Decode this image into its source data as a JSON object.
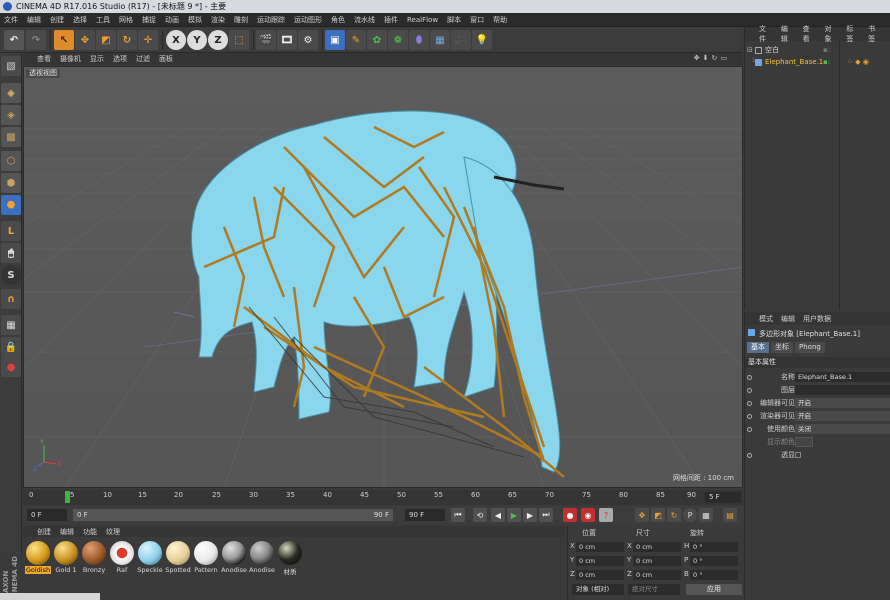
{
  "window": {
    "title": "CINEMA 4D R17.016 Studio (R17) - [未标题 9 *] - 主要"
  },
  "menubar": {
    "items": [
      "文件",
      "编辑",
      "创建",
      "选择",
      "工具",
      "网格",
      "捕捉",
      "动画",
      "模拟",
      "渲染",
      "雕刻",
      "运动跟踪",
      "运动图形",
      "角色",
      "流水线",
      "插件",
      "RealFlow",
      "脚本",
      "窗口",
      "帮助"
    ]
  },
  "viewport": {
    "menu": [
      "查看",
      "摄像机",
      "显示",
      "选项",
      "过滤",
      "面板"
    ],
    "name": "透视视图",
    "grid_spacing": "网格间距 : 100 cm"
  },
  "timeline": {
    "ticks": [
      "0",
      "5",
      "10",
      "15",
      "20",
      "25",
      "30",
      "35",
      "40",
      "45",
      "50",
      "55",
      "60",
      "65",
      "70",
      "75",
      "80",
      "85",
      "90"
    ],
    "current_frame": "5 F"
  },
  "transport": {
    "start_frame": "0 F",
    "range_start": "0 F",
    "range_end": "90 F",
    "end_frame": "90 F"
  },
  "materials": {
    "menu": [
      "创建",
      "编辑",
      "功能",
      "纹理"
    ],
    "items": [
      {
        "name": "Goldish",
        "color": "#d49a1a"
      },
      {
        "name": "Gold 1",
        "color": "#c4901e"
      },
      {
        "name": "Bronzy",
        "color": "#9a5a28"
      },
      {
        "name": "Raf",
        "color": "#e03a2a"
      },
      {
        "name": "Speckle",
        "color": "#8fd0e8"
      },
      {
        "name": "Spotted",
        "color": "#e5cf9a"
      },
      {
        "name": "Pattern",
        "color": "#e8e8e8"
      },
      {
        "name": "Anodise",
        "color": "#9a9a9a"
      },
      {
        "name": "Anodise",
        "color": "#8a8a8a"
      },
      {
        "name": "材质",
        "color": "#2a2a22"
      }
    ]
  },
  "coords": {
    "headers": [
      "位置",
      "尺寸",
      "旋转"
    ],
    "rows": [
      {
        "pos_label": "X",
        "pos": "0 cm",
        "size_label": "X",
        "size": "0 cm",
        "rot_label": "H",
        "rot": "0 °"
      },
      {
        "pos_label": "Y",
        "pos": "0 cm",
        "size_label": "Y",
        "size": "0 cm",
        "rot_label": "P",
        "rot": "0 °"
      },
      {
        "pos_label": "Z",
        "pos": "0 cm",
        "size_label": "Z",
        "size": "0 cm",
        "rot_label": "B",
        "rot": "0 °"
      }
    ],
    "mode": "对象 (相对)",
    "size_mode": "绝对尺寸",
    "apply": "应用"
  },
  "objects": {
    "menu": [
      "文件",
      "编辑",
      "查看",
      "对象",
      "标签",
      "书签"
    ],
    "items": [
      {
        "name": "空白"
      },
      {
        "name": "Elephant_Base.1"
      }
    ]
  },
  "attributes": {
    "menu": [
      "模式",
      "编辑",
      "用户数据"
    ],
    "title": "多边形对象 [Elephant_Base.1]",
    "tabs": [
      "基本",
      "坐标",
      "Phong"
    ],
    "section": "基本属性",
    "fields": [
      {
        "label": "名称",
        "value": "Elephant_Base.1"
      },
      {
        "label": "图层",
        "value": ""
      },
      {
        "label": "编辑器可见",
        "value": "开启"
      },
      {
        "label": "渲染器可见",
        "value": "开启"
      },
      {
        "label": "使用颜色",
        "value": "关闭"
      },
      {
        "label": "显示颜色",
        "value": ""
      },
      {
        "label": "透显",
        "value": ""
      }
    ]
  },
  "logo_text": "MAXON CINEMA 4D"
}
